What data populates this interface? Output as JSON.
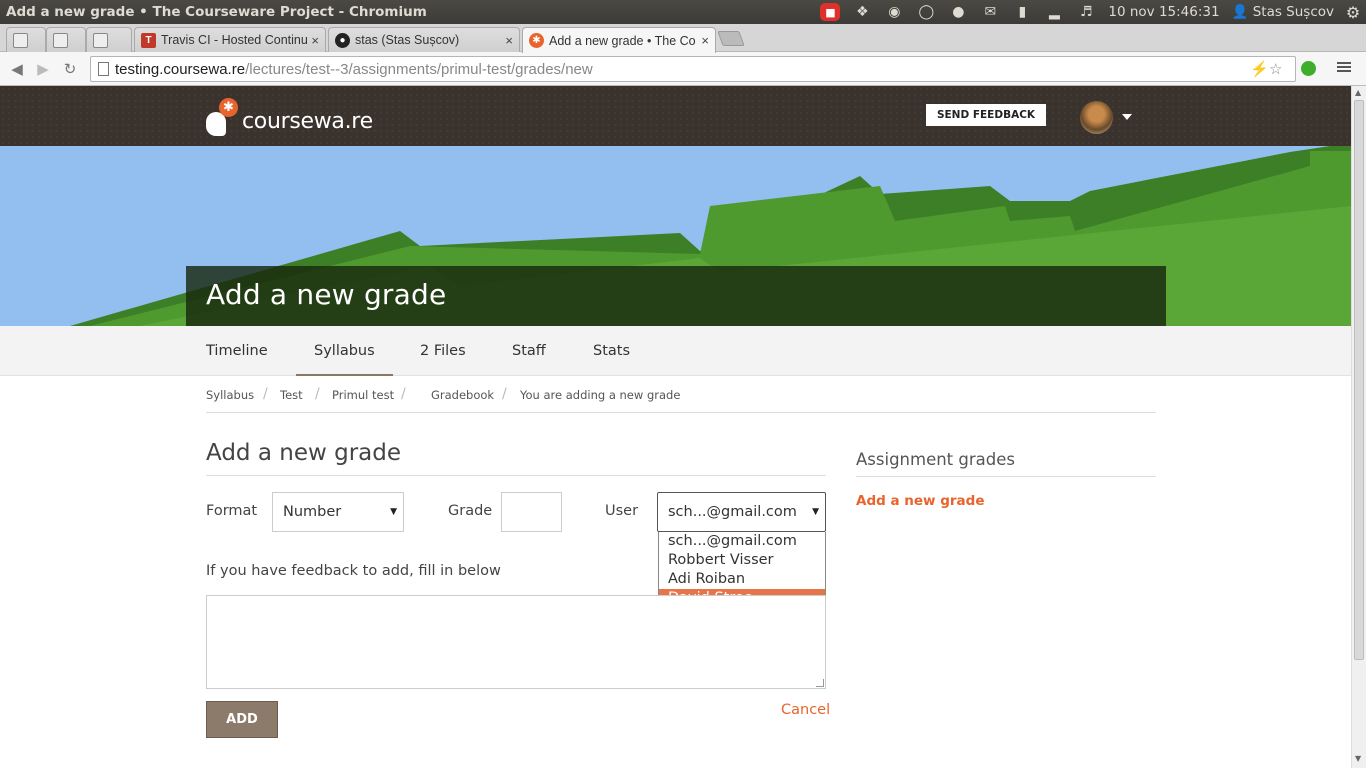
{
  "os": {
    "window_title": "Add a new grade • The Courseware Project - Chromium",
    "clock": "10 nov 15:46:31",
    "user": "Stas Sușcov"
  },
  "browser": {
    "tabs": [
      {
        "title": ""
      },
      {
        "title": ""
      },
      {
        "title": ""
      },
      {
        "title": "Travis CI - Hosted Continu"
      },
      {
        "title": "stas (Stas Sușcov)"
      },
      {
        "title": "Add a new grade • The Co"
      }
    ],
    "url_host": "testing.coursewa.re",
    "url_path": "/lectures/test--3/assignments/primul-test/grades/new"
  },
  "site": {
    "logo_text": "coursewa.re",
    "send_feedback": "SEND FEEDBACK",
    "page_heading": "Add a new grade",
    "nav": [
      {
        "label": "Timeline"
      },
      {
        "label": "Syllabus"
      },
      {
        "label": "2 Files"
      },
      {
        "label": "Staff"
      },
      {
        "label": "Stats"
      }
    ],
    "breadcrumb": [
      {
        "label": "Syllabus"
      },
      {
        "label": "Test"
      },
      {
        "label": "Primul test"
      },
      {
        "label": "Gradebook"
      },
      {
        "label": "You are adding a new grade"
      }
    ]
  },
  "form": {
    "title": "Add a new grade",
    "format_label": "Format",
    "format_value": "Number",
    "grade_label": "Grade",
    "grade_value": "",
    "user_label": "User",
    "user_value": "sch...@gmail.com",
    "user_options": [
      {
        "label": "sch...@gmail.com"
      },
      {
        "label": "Robbert Visser"
      },
      {
        "label": "Adi Roiban"
      },
      {
        "label": "David Stroe"
      }
    ],
    "highlighted_option": "David Stroe",
    "feedback_hint": "If you have feedback to add, fill in below",
    "feedback_value": "",
    "add_button": "ADD",
    "cancel_link": "Cancel"
  },
  "sidebar": {
    "title": "Assignment grades",
    "link": "Add a new grade"
  },
  "colors": {
    "accent": "#e8642c",
    "header_bg": "#3a322d",
    "sky": "#93bff0",
    "grass": "#4e9a2f",
    "button_bg": "#8c7a6b"
  }
}
